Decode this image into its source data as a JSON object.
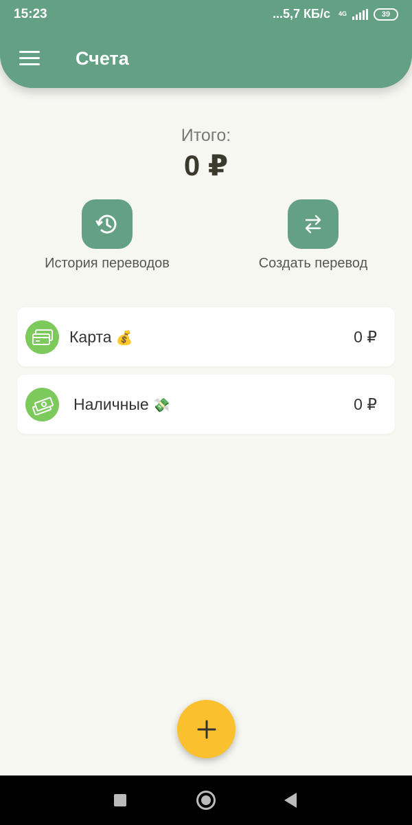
{
  "status_bar": {
    "time": "15:23",
    "net_speed": "...5,7 КБ/с",
    "net_type": "4G",
    "battery": "39"
  },
  "header": {
    "title": "Счета",
    "menu_icon": "hamburger-menu-icon"
  },
  "summary": {
    "label": "Итого:",
    "value": "0 ₽"
  },
  "actions": [
    {
      "label": "История переводов",
      "icon": "history-clock-icon"
    },
    {
      "label": "Создать перевод",
      "icon": "transfer-arrows-icon"
    }
  ],
  "accounts": [
    {
      "name": "Карта",
      "emoji": "💰",
      "amount": "0 ₽",
      "icon": "credit-cards-icon"
    },
    {
      "name": "Наличные",
      "emoji": "💸",
      "amount": "0 ₽",
      "icon": "cash-money-icon"
    }
  ],
  "fab": {
    "icon": "plus-icon"
  },
  "colors": {
    "primary": "#64a084",
    "account_icon_bg": "#7cc95c",
    "fab": "#fbc02d",
    "background": "#f7f7f2"
  }
}
